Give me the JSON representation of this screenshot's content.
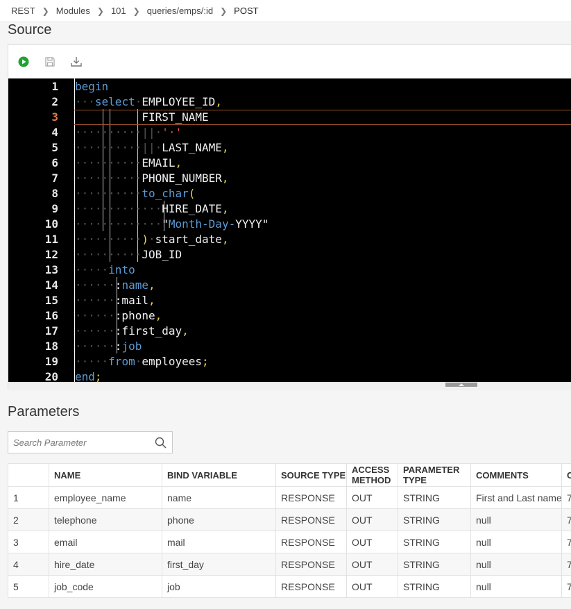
{
  "breadcrumb": {
    "items": [
      "REST",
      "Modules",
      "101",
      "queries/emps/:id"
    ],
    "current": "POST"
  },
  "source": {
    "title": "Source",
    "toolbar": [
      {
        "name": "run-icon",
        "color": "#1fa330"
      },
      {
        "name": "save-icon",
        "color": "#aaaaaa"
      },
      {
        "name": "download-icon",
        "color": "#777777"
      }
    ],
    "active_line": 3,
    "lines": [
      {
        "n": "1",
        "tokens": [
          {
            "t": "begin",
            "c": "kw"
          }
        ]
      },
      {
        "n": "2",
        "tokens": [
          {
            "t": "···",
            "c": "ws"
          },
          {
            "t": "select",
            "c": "kw"
          },
          {
            "t": "·",
            "c": "ws"
          },
          {
            "t": "EMPLOYEE_ID",
            "c": "id"
          },
          {
            "t": ",",
            "c": "pu"
          }
        ]
      },
      {
        "n": "3",
        "tokens": [
          {
            "t": "          ",
            "c": "ws"
          },
          {
            "t": "FIRST_NAME",
            "c": "id"
          }
        ]
      },
      {
        "n": "4",
        "tokens": [
          {
            "t": "··········",
            "c": "ws"
          },
          {
            "t": "||",
            "c": "ws"
          },
          {
            "t": "·",
            "c": "ws"
          },
          {
            "t": "'·'",
            "c": "str"
          }
        ]
      },
      {
        "n": "5",
        "tokens": [
          {
            "t": "··········",
            "c": "ws"
          },
          {
            "t": "||",
            "c": "ws"
          },
          {
            "t": "·",
            "c": "ws"
          },
          {
            "t": "LAST_NAME",
            "c": "id"
          },
          {
            "t": ",",
            "c": "pu"
          }
        ]
      },
      {
        "n": "6",
        "tokens": [
          {
            "t": "··········",
            "c": "ws"
          },
          {
            "t": "EMAIL",
            "c": "id"
          },
          {
            "t": ",",
            "c": "pu"
          }
        ]
      },
      {
        "n": "7",
        "tokens": [
          {
            "t": "··········",
            "c": "ws"
          },
          {
            "t": "PHONE_NUMBER",
            "c": "id"
          },
          {
            "t": ",",
            "c": "pu"
          }
        ]
      },
      {
        "n": "8",
        "tokens": [
          {
            "t": "··········",
            "c": "ws"
          },
          {
            "t": "to_char",
            "c": "fn"
          },
          {
            "t": "(",
            "c": "pu"
          }
        ]
      },
      {
        "n": "9",
        "tokens": [
          {
            "t": "·············",
            "c": "ws"
          },
          {
            "t": "HIRE_DATE",
            "c": "id"
          },
          {
            "t": ",",
            "c": "pu"
          }
        ]
      },
      {
        "n": "10",
        "tokens": [
          {
            "t": "·············",
            "c": "ws"
          },
          {
            "t": "\"",
            "c": "id"
          },
          {
            "t": "Month-Day-",
            "c": "kw"
          },
          {
            "t": "YYYY\"",
            "c": "id"
          }
        ]
      },
      {
        "n": "11",
        "tokens": [
          {
            "t": "··········",
            "c": "ws"
          },
          {
            "t": ")",
            "c": "pu"
          },
          {
            "t": "·",
            "c": "ws"
          },
          {
            "t": "start_date",
            "c": "id"
          },
          {
            "t": ",",
            "c": "pu"
          }
        ]
      },
      {
        "n": "12",
        "tokens": [
          {
            "t": "··········",
            "c": "ws"
          },
          {
            "t": "JOB_ID",
            "c": "id"
          }
        ]
      },
      {
        "n": "13",
        "tokens": [
          {
            "t": "·····",
            "c": "ws"
          },
          {
            "t": "into",
            "c": "kw"
          }
        ]
      },
      {
        "n": "14",
        "tokens": [
          {
            "t": "······",
            "c": "ws"
          },
          {
            "t": ":",
            "c": "id"
          },
          {
            "t": "name",
            "c": "kw"
          },
          {
            "t": ",",
            "c": "pu"
          }
        ]
      },
      {
        "n": "15",
        "tokens": [
          {
            "t": "······",
            "c": "ws"
          },
          {
            "t": ":mail",
            "c": "id"
          },
          {
            "t": ",",
            "c": "pu"
          }
        ]
      },
      {
        "n": "16",
        "tokens": [
          {
            "t": "······",
            "c": "ws"
          },
          {
            "t": ":phone",
            "c": "id"
          },
          {
            "t": ",",
            "c": "pu"
          }
        ]
      },
      {
        "n": "17",
        "tokens": [
          {
            "t": "······",
            "c": "ws"
          },
          {
            "t": ":first_day",
            "c": "id"
          },
          {
            "t": ",",
            "c": "pu"
          }
        ]
      },
      {
        "n": "18",
        "tokens": [
          {
            "t": "······",
            "c": "ws"
          },
          {
            "t": ":",
            "c": "id"
          },
          {
            "t": "job",
            "c": "kw"
          }
        ]
      },
      {
        "n": "19",
        "tokens": [
          {
            "t": "·····",
            "c": "ws"
          },
          {
            "t": "from",
            "c": "kw"
          },
          {
            "t": "·",
            "c": "ws"
          },
          {
            "t": "employees",
            "c": "id"
          },
          {
            "t": ";",
            "c": "pu"
          }
        ]
      },
      {
        "n": "20",
        "tokens": [
          {
            "t": "end",
            "c": "kw"
          },
          {
            "t": ";",
            "c": "pu"
          }
        ]
      }
    ]
  },
  "parameters": {
    "title": "Parameters",
    "search_placeholder": "Search Parameter",
    "columns": [
      "",
      "NAME",
      "BIND VARIABLE",
      "SOURCE TYPE",
      "ACCESS METHOD",
      "PARAMETER TYPE",
      "COMMENTS",
      "C"
    ],
    "rows": [
      [
        "1",
        "employee_name",
        "name",
        "RESPONSE",
        "OUT",
        "STRING",
        "First and Last name",
        "7"
      ],
      [
        "2",
        "telephone",
        "phone",
        "RESPONSE",
        "OUT",
        "STRING",
        "null",
        "7"
      ],
      [
        "3",
        "email",
        "mail",
        "RESPONSE",
        "OUT",
        "STRING",
        "null",
        "7"
      ],
      [
        "4",
        "hire_date",
        "first_day",
        "RESPONSE",
        "OUT",
        "STRING",
        "null",
        "7"
      ],
      [
        "5",
        "job_code",
        "job",
        "RESPONSE",
        "OUT",
        "STRING",
        "null",
        "7"
      ]
    ]
  }
}
